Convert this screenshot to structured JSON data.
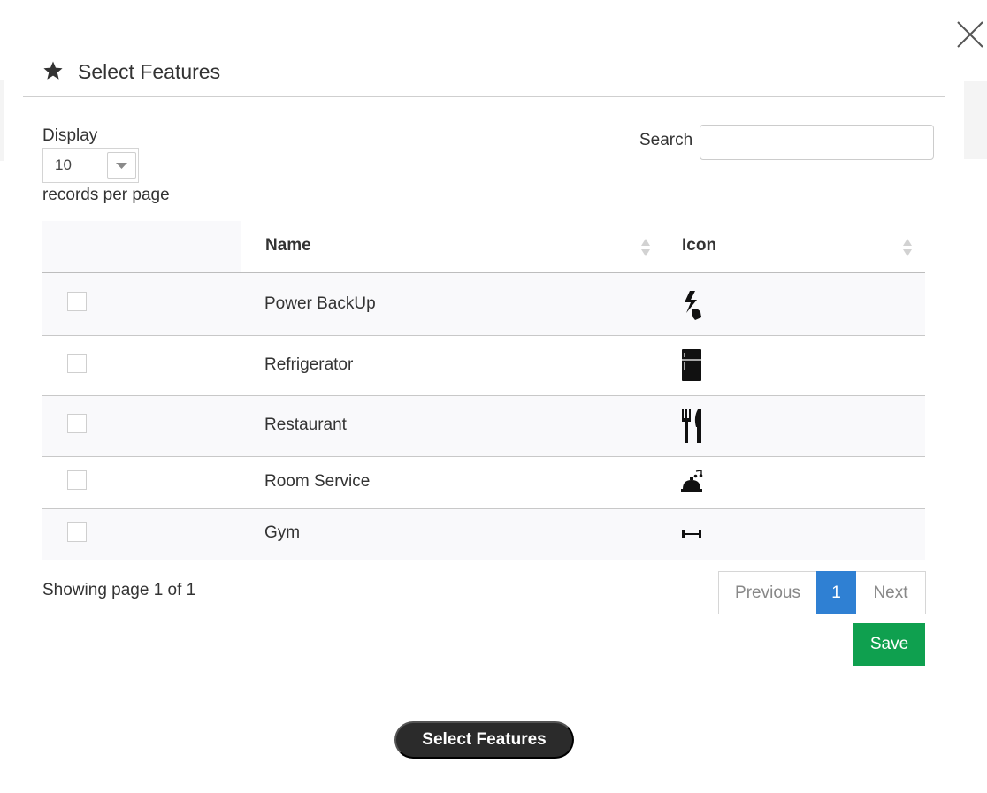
{
  "modal": {
    "title": "Select Features",
    "title_icon": "star-icon",
    "close_icon": "close-icon"
  },
  "length": {
    "display_label": "Display",
    "value": "10",
    "records_label": "records per page"
  },
  "search": {
    "label": "Search",
    "value": "",
    "placeholder": ""
  },
  "table": {
    "columns": [
      "Name",
      "Icon"
    ],
    "rows": [
      {
        "name": "Power BackUp",
        "icon": "power-backup-icon",
        "checked": false
      },
      {
        "name": "Refrigerator",
        "icon": "refrigerator-icon",
        "checked": false
      },
      {
        "name": "Restaurant",
        "icon": "restaurant-icon",
        "checked": false
      },
      {
        "name": "Room Service",
        "icon": "room-service-icon",
        "checked": false
      },
      {
        "name": "Gym",
        "icon": "gym-icon",
        "checked": false
      }
    ]
  },
  "info": "Showing page 1 of 1",
  "pagination": {
    "previous": "Previous",
    "current": "1",
    "next": "Next"
  },
  "save_label": "Save",
  "bottom_button_label": "Select Features",
  "colors": {
    "accent": "#2f80d3",
    "save": "#0fa04f",
    "dark_button": "#2b2b2b"
  }
}
